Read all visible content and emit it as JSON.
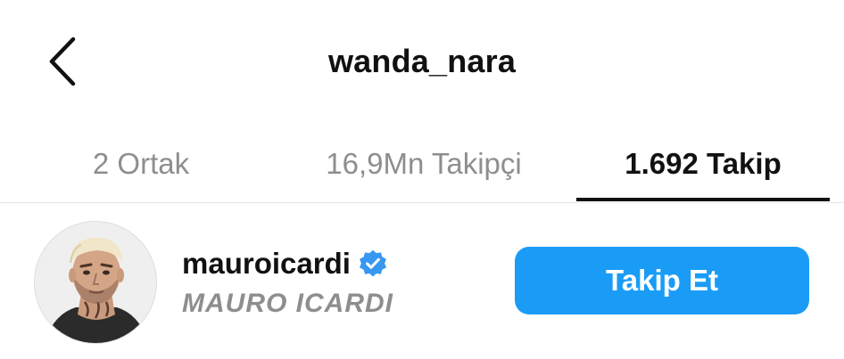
{
  "header": {
    "title": "wanda_nara",
    "back_icon": "chevron-left-icon"
  },
  "tabs": [
    {
      "label": "2 Ortak",
      "active": false
    },
    {
      "label": "16,9Mn Takipçi",
      "active": false
    },
    {
      "label": "1.692 Takip",
      "active": true
    }
  ],
  "user": {
    "username": "mauroicardi",
    "fullname": "MAURO ICARDI",
    "verified": true,
    "follow_label": "Takip Et"
  },
  "colors": {
    "accent": "#1a9cf6",
    "verified": "#3897f0",
    "muted_text": "#8e8e8e",
    "text": "#111111"
  }
}
